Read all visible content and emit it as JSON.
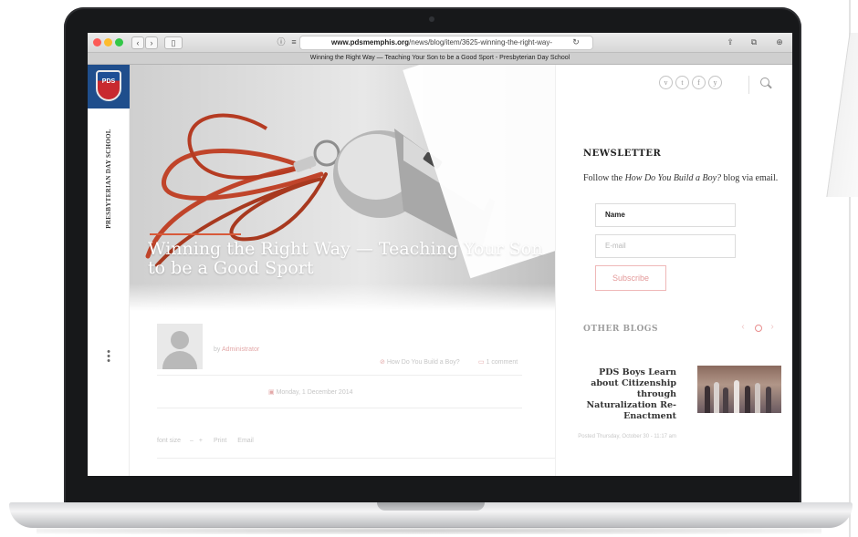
{
  "browser": {
    "address_host": "www.pdsmemphis.org",
    "address_path": "/news/blog/item/3625-winning-the-right-way-",
    "tab_title": "Winning the Right Way — Teaching Your Son to be a Good Sport - Presbyterian Day School"
  },
  "site": {
    "logo_text": "PDS",
    "school_name": "PRESBYTERIAN DAY SCHOOL"
  },
  "article": {
    "title": "Winning the Right Way — Teaching Your Son to be a Good Sport",
    "byline_prefix": "by",
    "author": "Administrator",
    "category": "How Do You Build a Boy?",
    "comments": "1 comment",
    "date": "Monday, 1 December 2014",
    "tools": {
      "font_size": "font size",
      "minus": "–",
      "plus": "+",
      "print": "Print",
      "email": "Email"
    }
  },
  "social": {
    "icons": [
      "vimeo-icon",
      "twitter-icon",
      "facebook-icon",
      "youtube-icon"
    ],
    "glyphs": [
      "v",
      "t",
      "f",
      "y"
    ]
  },
  "newsletter": {
    "heading": "NEWSLETTER",
    "text_before": "Follow the ",
    "text_italic": "How Do You Build a Boy?",
    "text_after": " blog via email.",
    "name_placeholder": "Name",
    "email_placeholder": "E-mail",
    "subscribe_label": "Subscribe"
  },
  "other_blogs": {
    "heading": "OTHER BLOGS",
    "item_title": "PDS Boys Learn about Citizenship through Naturalization Re-Enactment",
    "item_date": "Posted Thursday, October 30 - 11:17 am"
  },
  "colors": {
    "accent_red": "#d85a3a",
    "brand_blue": "#1f4e8c",
    "brand_red": "#c8292f"
  }
}
